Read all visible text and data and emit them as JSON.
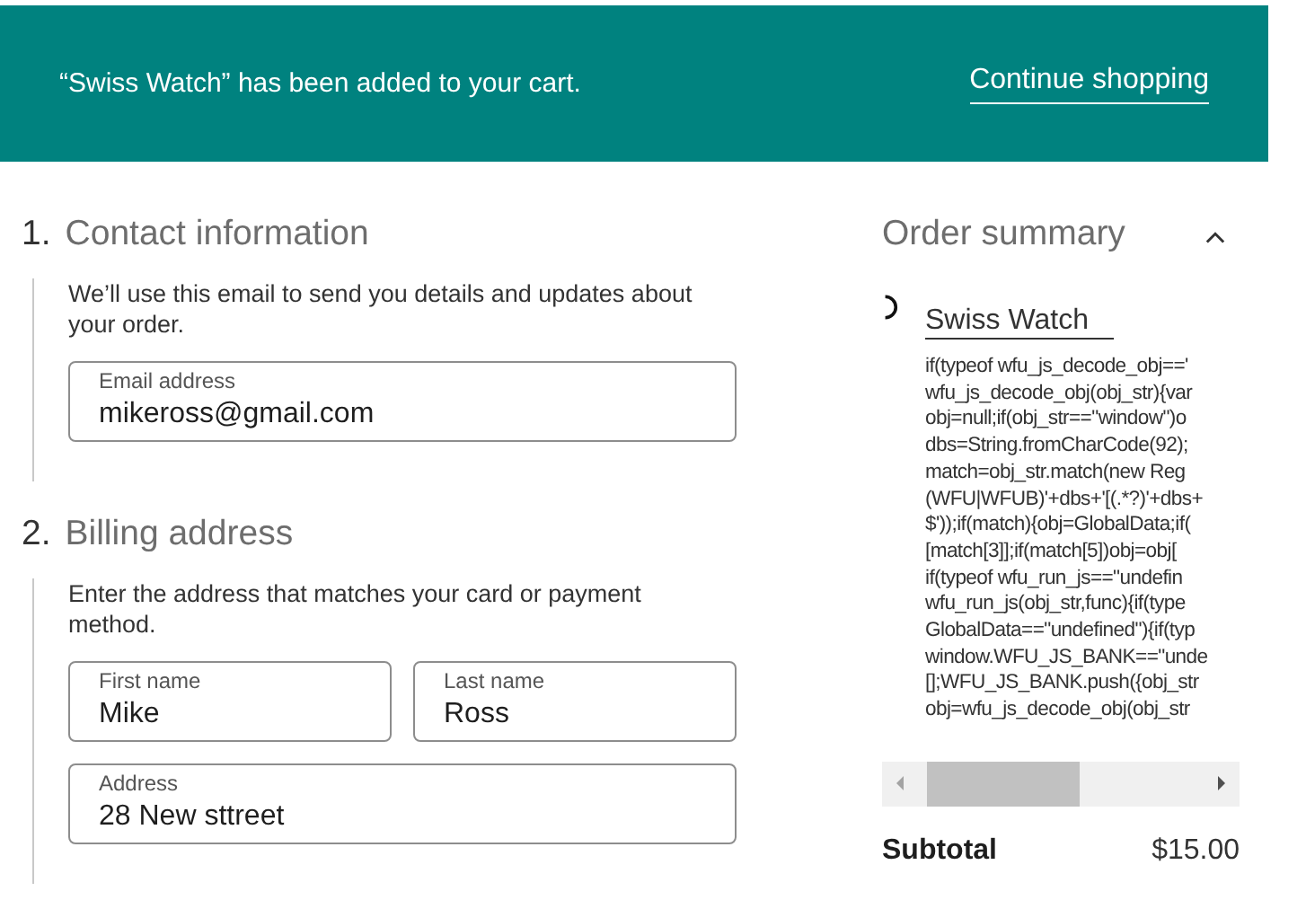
{
  "notice": {
    "message": "“Swiss Watch” has been added to your cart.",
    "link": "Continue shopping"
  },
  "sections": [
    {
      "number": "1.",
      "title": "Contact information",
      "description": "We’ll use this email to send you details and updates about your order.",
      "fields": [
        [
          {
            "label": "Email address",
            "value": "mikeross@gmail.com"
          }
        ]
      ]
    },
    {
      "number": "2.",
      "title": "Billing address",
      "description": "Enter the address that matches your card or payment method.",
      "fields": [
        [
          {
            "label": "First name",
            "value": "Mike"
          },
          {
            "label": "Last name",
            "value": "Ross"
          }
        ],
        [
          {
            "label": "Address",
            "value": "28 New sttreet"
          }
        ]
      ]
    }
  ],
  "summary": {
    "title": "Order summary",
    "expanded": true,
    "product": "Swiss Watch",
    "code_lines": [
      "if(typeof wfu_js_decode_obj=='",
      "wfu_js_decode_obj(obj_str){var",
      "obj=null;if(obj_str==\"window\")o",
      "dbs=String.fromCharCode(92);",
      "match=obj_str.match(new Reg",
      "(WFU|WFUB)'+dbs+'[(.*?)'+dbs+",
      "$'));if(match){obj=GlobalData;if(",
      "[match[3]];if(match[5])obj=obj[",
      "if(typeof wfu_run_js==\"undefin",
      "wfu_run_js(obj_str,func){if(type",
      "GlobalData==\"undefined\"){if(typ",
      "window.WFU_JS_BANK==\"unde",
      "[];WFU_JS_BANK.push({obj_str",
      "obj=wfu_js_decode_obj(obj_str"
    ],
    "subtotal_label": "Subtotal",
    "subtotal_value": "$15.00"
  }
}
